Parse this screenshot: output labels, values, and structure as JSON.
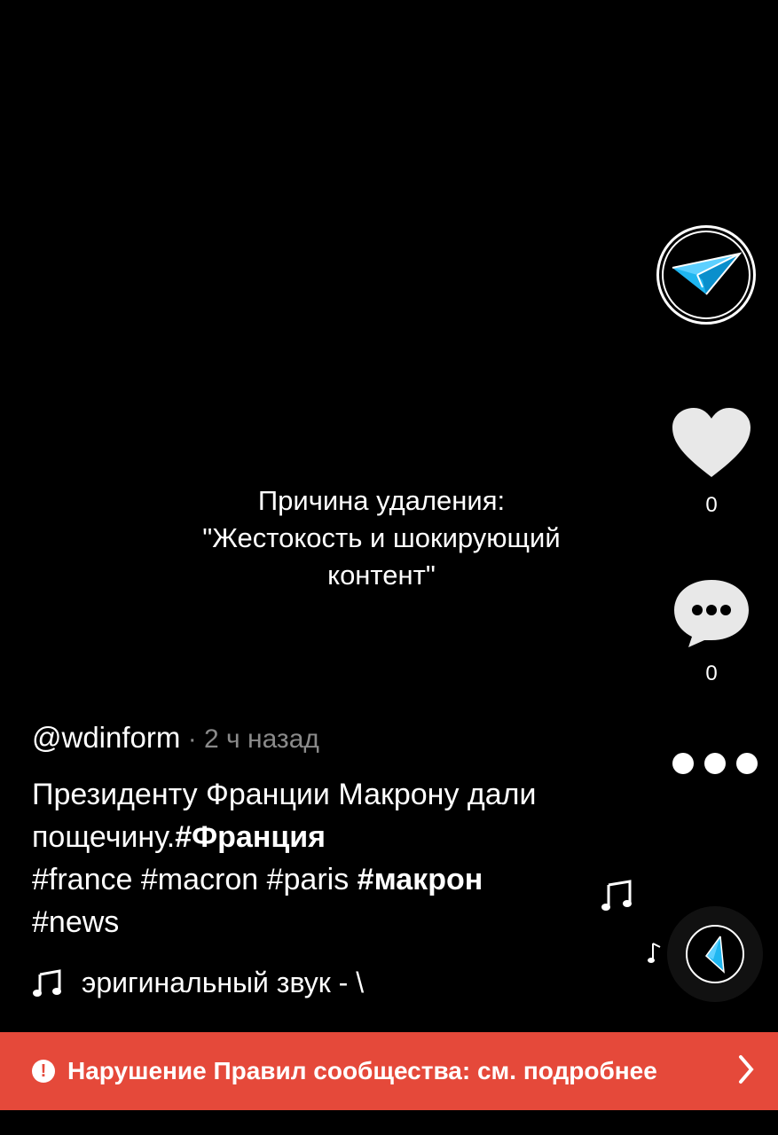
{
  "removal_notice": {
    "line1": "Причина удаления:",
    "line2": "\"Жестокость и шокирующий",
    "line3": "контент\""
  },
  "sidebar": {
    "avatar_icon": "paper-plane-icon",
    "like_icon": "heart-icon",
    "like_count": "0",
    "comment_icon": "comment-bubble-icon",
    "comment_count": "0",
    "more_icon": "more-dots-icon"
  },
  "post": {
    "handle": "@wdinform",
    "time": " · 2 ч назад",
    "caption_text": "Президенту Франции Макрону дали пощечину.",
    "tag_bold_1": "#Франция",
    "tag_2": "#france",
    "tag_3": "#macron",
    "tag_4": "#paris",
    "tag_bold_5": "#макрон",
    "tag_6": "#news",
    "sound_text": "эригинальный звук - \\"
  },
  "banner": {
    "text": "Нарушение Правил сообщества: см. подробнее",
    "accent": "#e5493a"
  }
}
